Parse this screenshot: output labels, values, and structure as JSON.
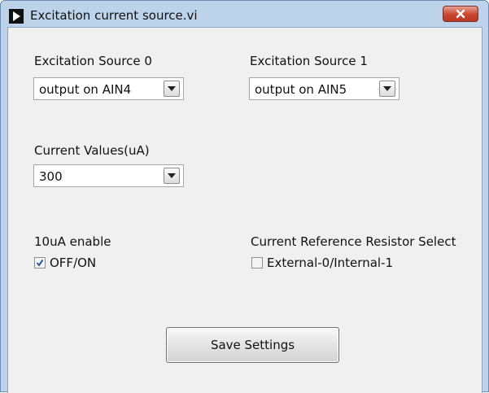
{
  "window": {
    "title": "Excitation current source.vi",
    "icon": "run-arrow-icon",
    "close_icon": "close-icon"
  },
  "excitation_source_0": {
    "label": "Excitation Source 0",
    "value": "output on AIN4"
  },
  "excitation_source_1": {
    "label": "Excitation Source 1",
    "value": "output on AIN5"
  },
  "current_values": {
    "label": "Current Values(uA)",
    "value": "300"
  },
  "enable_10ua": {
    "label": "10uA enable",
    "checkbox_label": "OFF/ON",
    "checked": true
  },
  "reference_resistor": {
    "label": "Current Reference Resistor Select",
    "checkbox_label": "External-0/Internal-1",
    "checked": false
  },
  "save_button": {
    "label": "Save Settings"
  },
  "colors": {
    "frame": "#bcd3ea",
    "panel": "#f0f0f0",
    "close_button": "#c8452f",
    "checkmark": "#2a5ba8"
  }
}
